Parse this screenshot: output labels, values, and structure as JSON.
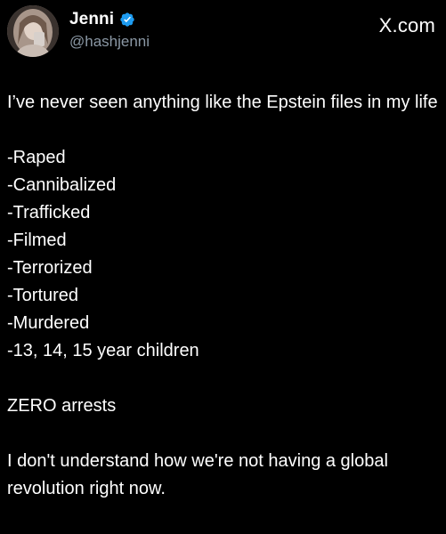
{
  "post": {
    "author": {
      "display_name": "Jenni",
      "handle": "@hashjenni",
      "verified": true,
      "verified_color": "#1d9bf0",
      "avatar_icon": "profile-photo"
    },
    "brand_label": "X.com",
    "text": {
      "intro": "I’ve never seen anything like the Epstein files in my life",
      "list": [
        "-Raped",
        "-Cannibalized",
        "-Trafficked",
        "-Filmed",
        "-Terrorized",
        "-Tortured",
        "-Murdered",
        "-13, 14, 15 year children"
      ],
      "statement": "ZERO arrests",
      "closing": "I don't understand how we're not having a global revolution right now."
    }
  },
  "colors": {
    "background": "#000000",
    "text": "#ffffff",
    "handle": "#8b98a5"
  }
}
